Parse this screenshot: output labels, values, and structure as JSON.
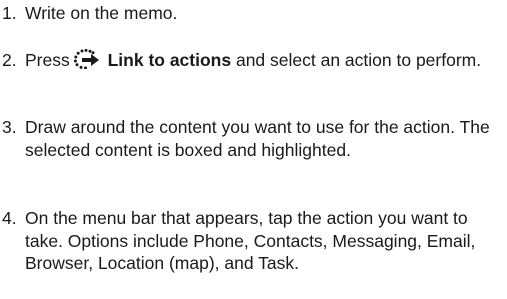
{
  "steps": [
    {
      "number": "1.",
      "text": "Write on the memo."
    },
    {
      "number": "2.",
      "prefix": "Press",
      "icon": "link-to-actions-icon",
      "bold": "Link to actions",
      "suffix": "and select an action to perform."
    },
    {
      "number": "3.",
      "text": "Draw around the content you want to use for the action. The selected content is boxed and highlighted."
    },
    {
      "number": "4.",
      "text": "On the menu bar that appears, tap the action you want to take. Options include Phone, Contacts, Messaging, Email, Browser, Location (map), and Task."
    }
  ]
}
